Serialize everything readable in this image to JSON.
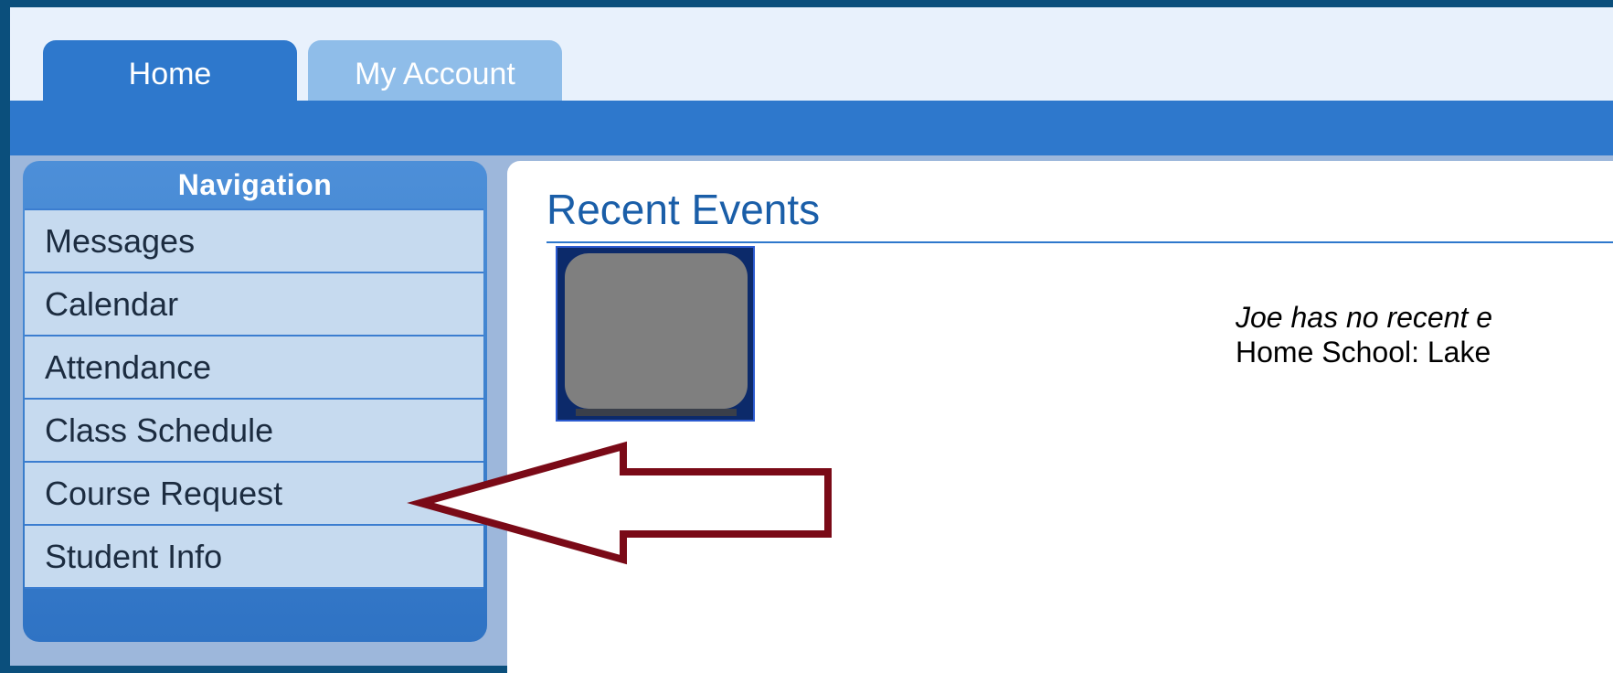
{
  "tabs": [
    {
      "label": "Home",
      "active": true
    },
    {
      "label": "My Account",
      "active": false
    }
  ],
  "nav": {
    "title": "Navigation",
    "items": [
      {
        "label": "Messages"
      },
      {
        "label": "Calendar"
      },
      {
        "label": "Attendance"
      },
      {
        "label": "Class Schedule"
      },
      {
        "label": "Course Request"
      },
      {
        "label": "Student Info"
      }
    ]
  },
  "main": {
    "title": "Recent Events",
    "event_note": "Joe has no recent e",
    "home_school": "Home School: Lake"
  },
  "annotation": {
    "arrow_color": "#7a0a17",
    "points_to": "Course Request"
  },
  "colors": {
    "accent": "#2e78cc",
    "outer_frame": "#0b4f7c",
    "nav_item_bg": "#c6daef"
  }
}
